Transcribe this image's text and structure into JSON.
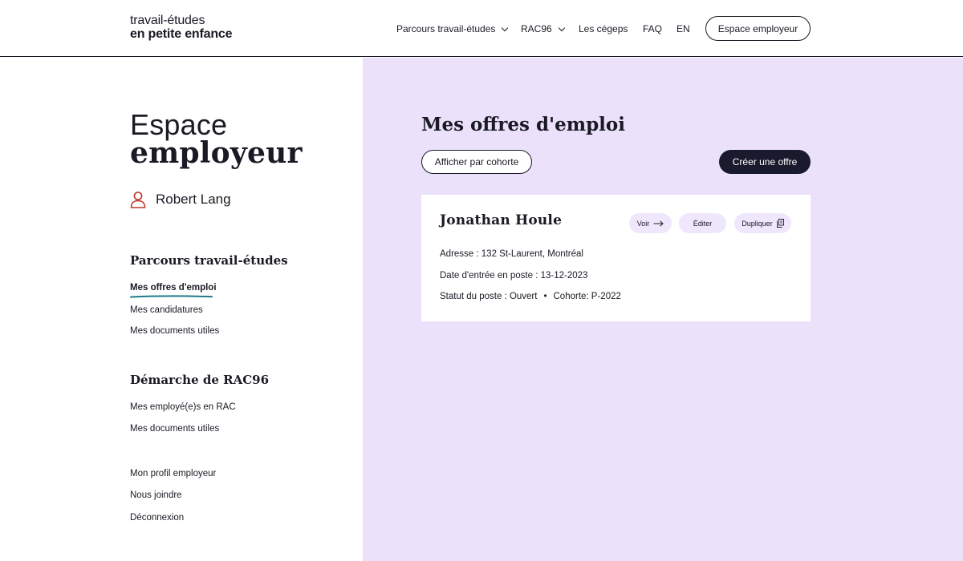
{
  "logo": {
    "line1": "travail-études",
    "line2": "en petite enfance"
  },
  "nav": {
    "items": [
      {
        "label": "Parcours travail-études",
        "dropdown": true
      },
      {
        "label": "RAC96",
        "dropdown": true
      },
      {
        "label": "Les cégeps",
        "dropdown": false
      },
      {
        "label": "FAQ",
        "dropdown": false
      },
      {
        "label": "EN",
        "dropdown": false
      }
    ],
    "employer_button": "Espace employeur"
  },
  "sidebar": {
    "title_light": "Espace",
    "title_bold": "employeur",
    "user_name": "Robert Lang",
    "section1": {
      "heading": "Parcours travail-études",
      "links": [
        "Mes offres d'emploi",
        "Mes candidatures",
        "Mes documents utiles"
      ]
    },
    "section2": {
      "heading": "Démarche de RAC96",
      "links": [
        "Mes employé(e)s en RAC",
        "Mes documents utiles"
      ]
    },
    "footer_links": [
      "Mon profil employeur",
      "Nous joindre",
      "Déconnexion"
    ]
  },
  "main": {
    "title": "Mes offres d'emploi",
    "cohort_button": "Afficher par cohorte",
    "create_button": "Créer une offre",
    "card": {
      "name": "Jonathan Houle",
      "view": "Voir",
      "edit": "Éditer",
      "duplicate": "Dupliquer",
      "address": "Adresse : 132 St-Laurent, Montréal",
      "start_date": "Date d'entrée en poste : 13-12-2023",
      "status": "Statut du poste : Ouvert",
      "cohort": "Cohorte: P-2022"
    }
  },
  "colors": {
    "accent_purple": "#ebe1fb",
    "dark": "#1a1a2e",
    "underline_teal": "#1e7a8a",
    "user_icon_red": "#c0392b"
  }
}
